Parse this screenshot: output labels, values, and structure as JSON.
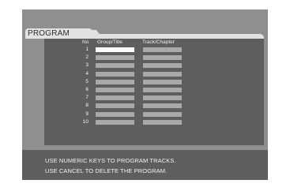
{
  "screen": {
    "title": "PROGRAM",
    "columns": {
      "no": "No",
      "group": "Group/Title",
      "track": "Track/Chapter"
    },
    "rows": [
      {
        "no": "1",
        "group": "",
        "track": ""
      },
      {
        "no": "2",
        "group": "",
        "track": ""
      },
      {
        "no": "3",
        "group": "",
        "track": ""
      },
      {
        "no": "4",
        "group": "",
        "track": ""
      },
      {
        "no": "5",
        "group": "",
        "track": ""
      },
      {
        "no": "6",
        "group": "",
        "track": ""
      },
      {
        "no": "7",
        "group": "",
        "track": ""
      },
      {
        "no": "8",
        "group": "",
        "track": ""
      },
      {
        "no": "9",
        "group": "",
        "track": ""
      },
      {
        "no": "10",
        "group": "",
        "track": ""
      }
    ],
    "selected_row": 1,
    "selected_column": "group",
    "messages": [
      "USE NUMERIC KEYS TO PROGRAM TRACKS.",
      "USE CANCEL TO DELETE THE PROGRAM."
    ]
  },
  "colors": {
    "screen_bg": "#8f8f8f",
    "panel_bg": "#5e5e5e",
    "tab_bg": "#e2e2e2",
    "cell_empty": "#a9a9a9",
    "cell_selected": "#ffffff"
  }
}
